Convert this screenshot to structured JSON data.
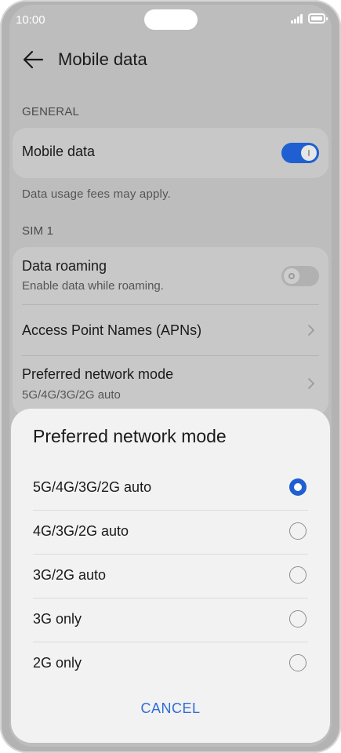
{
  "status": {
    "time": "10:00"
  },
  "header": {
    "title": "Mobile data",
    "back_icon": "arrow-left-icon"
  },
  "general": {
    "label": "GENERAL",
    "mobile_data": {
      "title": "Mobile data",
      "enabled": true
    },
    "note": "Data usage fees may apply."
  },
  "sim": {
    "label": "SIM 1",
    "roaming": {
      "title": "Data roaming",
      "subtitle": "Enable data while roaming.",
      "enabled": false
    },
    "apn": {
      "title": "Access Point Names (APNs)"
    },
    "network_mode": {
      "title": "Preferred network mode",
      "subtitle": "5G/4G/3G/2G auto"
    }
  },
  "dialog": {
    "title": "Preferred network mode",
    "options": [
      {
        "label": "5G/4G/3G/2G auto",
        "selected": true
      },
      {
        "label": "4G/3G/2G auto",
        "selected": false
      },
      {
        "label": "3G/2G auto",
        "selected": false
      },
      {
        "label": "3G only",
        "selected": false
      },
      {
        "label": "2G only",
        "selected": false
      }
    ],
    "cancel": "CANCEL"
  },
  "colors": {
    "accent": "#1f5fd2",
    "dim_background": "#bdbdbd",
    "sheet": "#f2f2f2",
    "cancel_text": "#2f6cd6"
  }
}
